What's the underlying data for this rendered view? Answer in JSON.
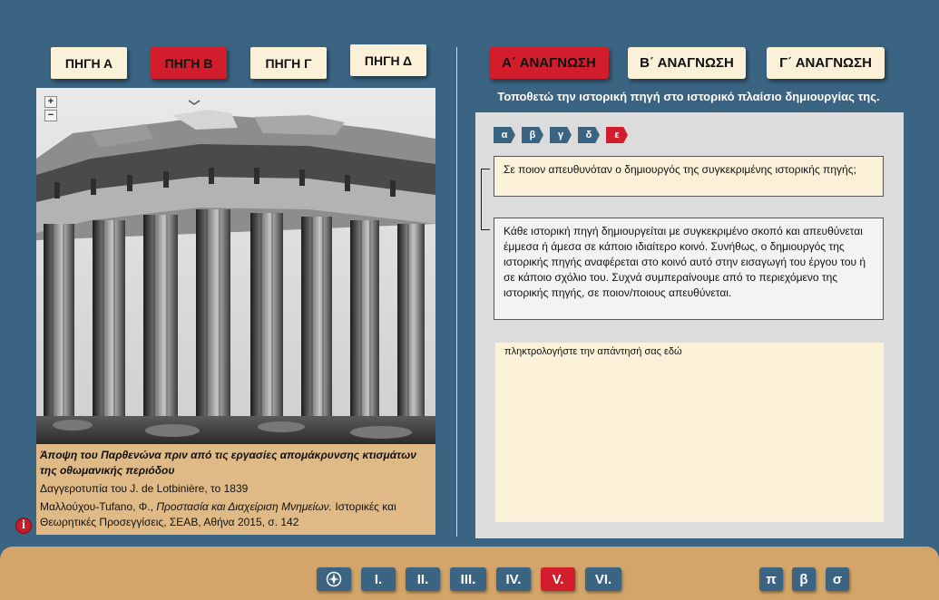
{
  "sources": {
    "tabs": [
      {
        "label": "ΠΗΓΗ Α"
      },
      {
        "label": "ΠΗΓΗ Β"
      },
      {
        "label": "ΠΗΓΗ Γ"
      },
      {
        "label": "ΠΗΓΗ Δ"
      }
    ],
    "active_index": 1
  },
  "readings": {
    "tabs": [
      {
        "label": "Α΄ ΑΝΑΓΝΩΣΗ"
      },
      {
        "label": "Β΄ ΑΝΑΓΝΩΣΗ"
      },
      {
        "label": "Γ΄ ΑΝΑΓΝΩΣΗ"
      }
    ],
    "active_index": 0
  },
  "image": {
    "zoom_in": "+",
    "zoom_out": "−"
  },
  "caption": {
    "title": "Άποψη του Παρθενώνα πριν από τις εργασίες απομάκρυνσης κτισμάτων της οθωμανικής περιόδου",
    "credit": "Δαγγεροτυπία του J. de Lotbinière, το 1839",
    "reference_author": "Μαλλούχου-Tufano, Φ., ",
    "reference_title": "Προστασία και Διαχείριση Μνημείων.",
    "reference_rest": " Ιστορικές και Θεωρητικές Προσεγγίσεις, ΣΕΑΒ, Αθήνα 2015, σ. 142",
    "info_icon": "i"
  },
  "instruction": "Τοποθετώ την ιστορική πηγή στο ιστορικό πλαίσιο δημιουργίας της.",
  "steps": {
    "items": [
      "α",
      "β",
      "γ",
      "δ",
      "ε"
    ],
    "active_index": 4
  },
  "question": "Σε ποιον απευθυνόταν ο δημιουργός της συγκεκριμένης ιστορικής πηγής;",
  "hint": "Κάθε ιστορική πηγή δημιουργείται με συγκεκριμένο σκοπό και απευθύνεται έμμεσα ή άμεσα σε κάποιο ιδιαίτερο κοινό. Συνήθως, ο δημιουργός της ιστορικής πηγής αναφέρεται στο κοινό αυτό στην εισαγωγή του έργου του ή σε κάποιο σχόλιο του. Συχνά συμπεραίνουμε από το περιεχόμενο της ιστορικής πηγής, σε ποιον/ποιους απευθύνεται.",
  "response": {
    "value": "",
    "placeholder": "πληκτρολογήστε την απάντησή σας εδώ"
  },
  "bottom_nav": {
    "compass_icon": "compass-icon",
    "sections": [
      "I.",
      "II.",
      "III.",
      "IV.",
      "V.",
      "VI."
    ],
    "active_index": 4,
    "tools": [
      "π",
      "β",
      "σ"
    ]
  },
  "colors": {
    "background": "#3a6482",
    "accent_red": "#d11d2c",
    "cream": "#fbf1d8",
    "tan": "#d3a569"
  }
}
